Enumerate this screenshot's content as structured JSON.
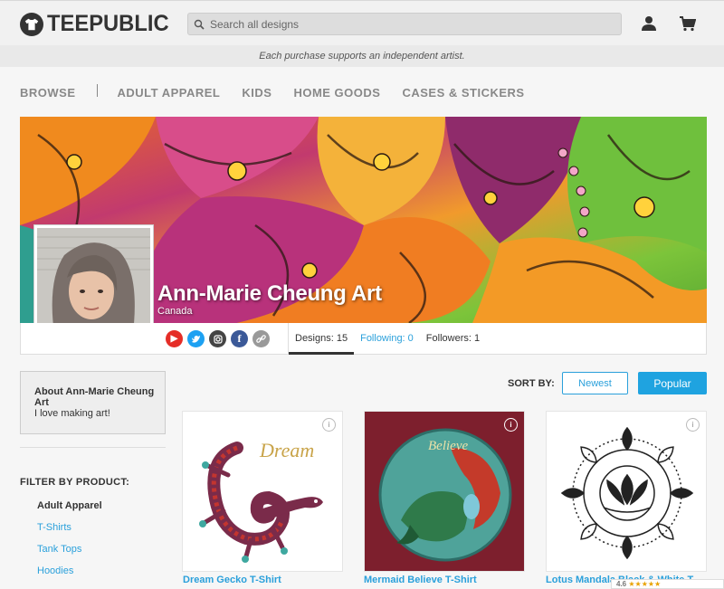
{
  "header": {
    "logo_text": "TEEPUBLIC",
    "search_placeholder": "Search all designs",
    "tagline": "Each purchase supports an independent artist."
  },
  "nav": {
    "items": [
      "BROWSE",
      "ADULT APPAREL",
      "KIDS",
      "HOME GOODS",
      "CASES & STICKERS"
    ]
  },
  "profile": {
    "name": "Ann-Marie Cheung Art",
    "location": "Canada",
    "stats": {
      "designs": "Designs: 15",
      "following": "Following: 0",
      "followers": "Followers: 1"
    },
    "socials": [
      {
        "icon": "youtube-icon",
        "color": "#e52d27"
      },
      {
        "icon": "twitter-icon",
        "color": "#1da1f2"
      },
      {
        "icon": "instagram-icon",
        "color": "#444444"
      },
      {
        "icon": "facebook-icon",
        "color": "#3b5998"
      },
      {
        "icon": "link-icon",
        "color": "#999999"
      }
    ]
  },
  "sidebar": {
    "about_title": "About Ann-Marie Cheung Art",
    "about_text": "I love making art!",
    "filter_title": "FILTER BY PRODUCT:",
    "filter_items": [
      "Adult Apparel",
      "T-Shirts",
      "Tank Tops",
      "Hoodies"
    ]
  },
  "sort": {
    "label": "SORT BY:",
    "options": [
      "Newest",
      "Popular"
    ],
    "selected": "Popular"
  },
  "products": [
    {
      "title": "Dream Gecko T-Shirt"
    },
    {
      "title": "Mermaid Believe T-Shirt"
    },
    {
      "title": "Lotus Mandala Black & White T-..."
    }
  ],
  "rating": {
    "score": "4.6",
    "stars": "★★★★★"
  }
}
